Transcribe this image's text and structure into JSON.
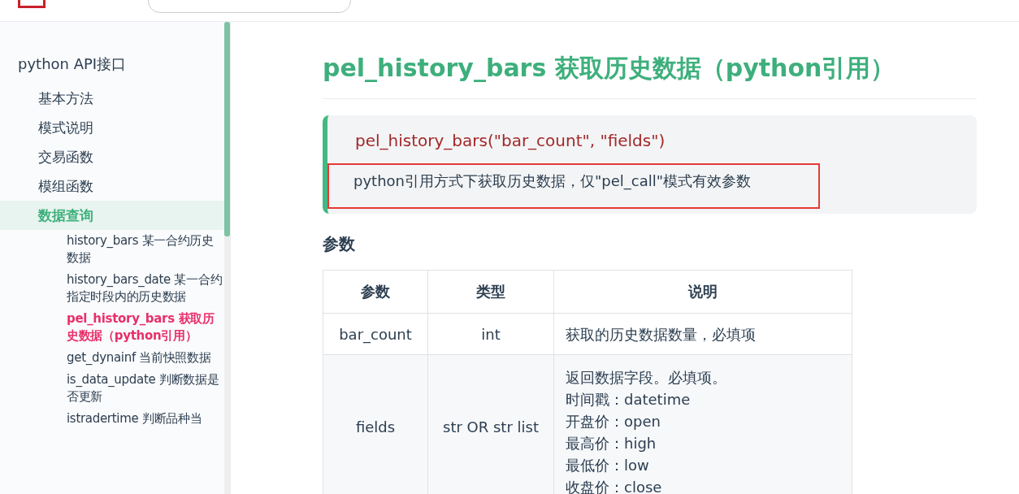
{
  "sidebar": {
    "section": "python API接口",
    "items": [
      {
        "label": "基本方法",
        "selected": false
      },
      {
        "label": "模式说明",
        "selected": false
      },
      {
        "label": "交易函数",
        "selected": false
      },
      {
        "label": "模组函数",
        "selected": false
      },
      {
        "label": "数据查询",
        "selected": true,
        "children": [
          {
            "label": "history_bars 某一合约历史数据",
            "selected": false
          },
          {
            "label": "history_bars_date 某一合约指定时段内的历史数据",
            "selected": false
          },
          {
            "label": "pel_history_bars 获取历史数据（python引用）",
            "selected": true
          },
          {
            "label": "get_dynainf 当前快照数据",
            "selected": false
          },
          {
            "label": "is_data_update 判断数据是否更新",
            "selected": false
          },
          {
            "label": "istradertime 判断品种当",
            "selected": false
          }
        ]
      }
    ]
  },
  "article": {
    "title": "pel_history_bars 获取历史数据（python引用）",
    "signature": "pel_history_bars(\"bar_count\", \"fields\")",
    "description": "python引用方式下获取历史数据，仅\"pel_call\"模式有效参数",
    "params_heading": "参数",
    "table": {
      "columns": [
        "参数",
        "类型",
        "说明"
      ],
      "rows": [
        {
          "cells": [
            "bar_count",
            "int"
          ],
          "description": [
            "获取的历史数据数量，必填项"
          ]
        },
        {
          "cells": [
            "fields",
            "str OR str list"
          ],
          "description": [
            "返回数据字段。必填项。",
            "时间戳：datetime",
            "开盘价：open",
            "最高价：high",
            "最低价：low",
            "收盘价：close"
          ]
        }
      ]
    }
  }
}
